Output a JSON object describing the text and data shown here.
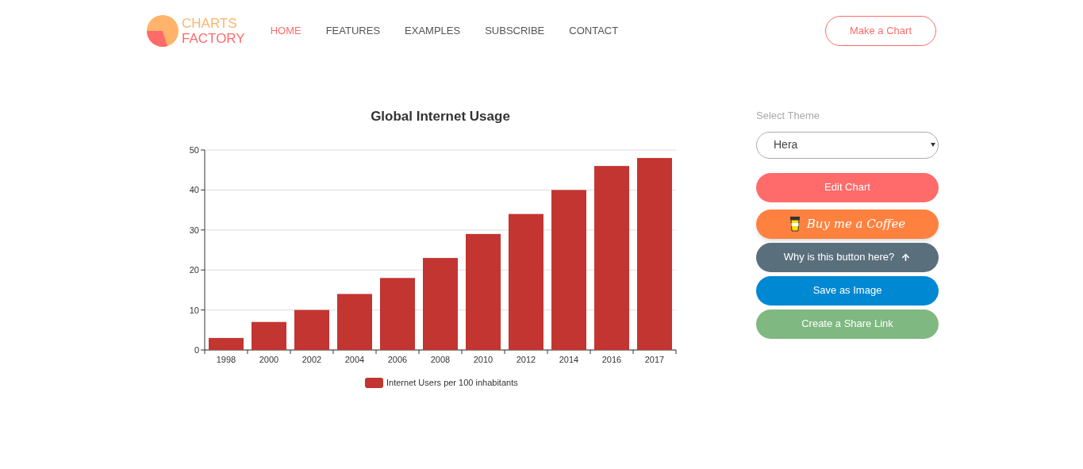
{
  "logo": {
    "line_1": "CHARTS",
    "line_2": "FACTORY"
  },
  "nav": [
    {
      "label": "HOME",
      "selected": true
    },
    {
      "label": "FEATURES",
      "selected": false
    },
    {
      "label": "EXAMPLES",
      "selected": false
    },
    {
      "label": "SUBSCRIBE",
      "selected": false
    },
    {
      "label": "CONTACT",
      "selected": false
    }
  ],
  "header_button": "Make a Chart",
  "chart": {
    "chart_data": {
      "type": "bar",
      "title": "Global Internet Usage",
      "categories": [
        "1998",
        "2000",
        "2002",
        "2004",
        "2006",
        "2008",
        "2010",
        "2012",
        "2014",
        "2016",
        "2017"
      ],
      "series": [
        {
          "name": "Internet Users per 100 inhabitants",
          "color": "#c23531",
          "values": [
            3,
            7,
            10,
            14,
            18,
            23,
            29,
            34,
            40,
            46,
            48
          ]
        }
      ],
      "ylim": [
        0,
        50
      ],
      "grid": true,
      "yticks": [
        0,
        10,
        20,
        30,
        40,
        50
      ]
    }
  },
  "sidebar": {
    "theme_label": "Select Theme",
    "theme_value": "Hera",
    "buttons": [
      {
        "kind": "edit",
        "label": "Edit Chart"
      },
      {
        "kind": "coffee",
        "label": "Buy me a Coffee"
      },
      {
        "kind": "why",
        "label": "Why is this button here?"
      },
      {
        "kind": "save",
        "label": "Save as Image"
      },
      {
        "kind": "share",
        "label": "Create a Share Link"
      }
    ]
  }
}
